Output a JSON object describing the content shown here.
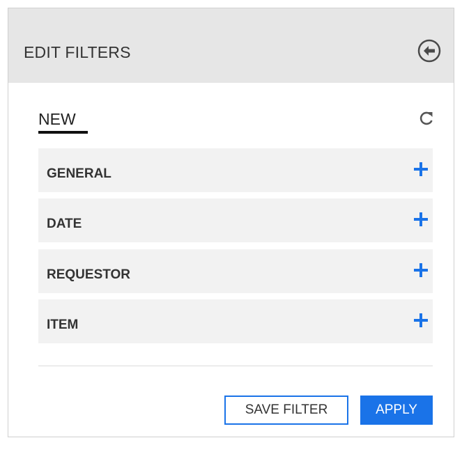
{
  "header": {
    "title": "EDIT FILTERS",
    "back_icon": "circle-arrow-left-icon"
  },
  "tab": {
    "label": "NEW",
    "refresh_icon": "refresh-icon"
  },
  "sections": [
    {
      "label": "GENERAL",
      "icon": "plus-icon"
    },
    {
      "label": "DATE",
      "icon": "plus-icon"
    },
    {
      "label": "REQUESTOR",
      "icon": "plus-icon"
    },
    {
      "label": "ITEM",
      "icon": "plus-icon"
    }
  ],
  "actions": {
    "save_label": "SAVE FILTER",
    "apply_label": "APPLY"
  },
  "colors": {
    "accent": "#1a73e8",
    "header_bg": "#e6e6e6",
    "section_bg": "#f2f2f2"
  }
}
